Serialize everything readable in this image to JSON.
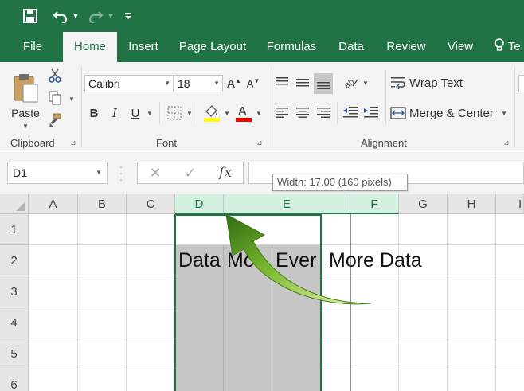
{
  "app": {
    "accent": "#217346"
  },
  "tabs": [
    {
      "label": "File"
    },
    {
      "label": "Home",
      "active": true
    },
    {
      "label": "Insert"
    },
    {
      "label": "Page Layout"
    },
    {
      "label": "Formulas"
    },
    {
      "label": "Data"
    },
    {
      "label": "Review"
    },
    {
      "label": "View"
    },
    {
      "label": "Te"
    }
  ],
  "ribbon": {
    "clipboard": {
      "label": "Clipboard",
      "paste_label": "Paste"
    },
    "font": {
      "label": "Font",
      "name": "Calibri",
      "size": "18",
      "bold": "B",
      "italic": "I",
      "underline": "U",
      "font_color": "#ff0000",
      "highlight_color": "#ffff00"
    },
    "alignment": {
      "label": "Alignment",
      "wrap_text": "Wrap Text",
      "merge_center": "Merge & Center"
    }
  },
  "formula_bar": {
    "name_box": "D1",
    "fx_label": "fx",
    "formula": ""
  },
  "tooltip": {
    "text": "Width: 17.00 (160 pixels)"
  },
  "grid": {
    "columns": [
      "A",
      "B",
      "C",
      "D",
      "E",
      "F",
      "G",
      "H",
      "I"
    ],
    "selected_columns": [
      "D",
      "E"
    ],
    "rows": [
      "1",
      "2",
      "3",
      "4",
      "5",
      "6"
    ],
    "cells": {
      "D2": "Data",
      "E2a": "Mor",
      "E2b": "Ever",
      "F2": "More Data"
    }
  },
  "icons": [
    "save-icon",
    "undo-icon",
    "redo-icon",
    "customize-icon",
    "lightbulb-icon",
    "paste-icon",
    "cut-icon",
    "copy-icon",
    "format-painter-icon",
    "increase-font-icon",
    "decrease-font-icon",
    "borders-icon",
    "fill-color-icon",
    "font-color-icon",
    "align-top-icon",
    "align-middle-icon",
    "align-bottom-icon",
    "orientation-icon",
    "align-left-icon",
    "align-center-icon",
    "align-right-icon",
    "decrease-indent-icon",
    "increase-indent-icon",
    "wrap-text-icon",
    "merge-center-icon",
    "cancel-icon",
    "enter-icon",
    "callout-arrow-icon"
  ]
}
